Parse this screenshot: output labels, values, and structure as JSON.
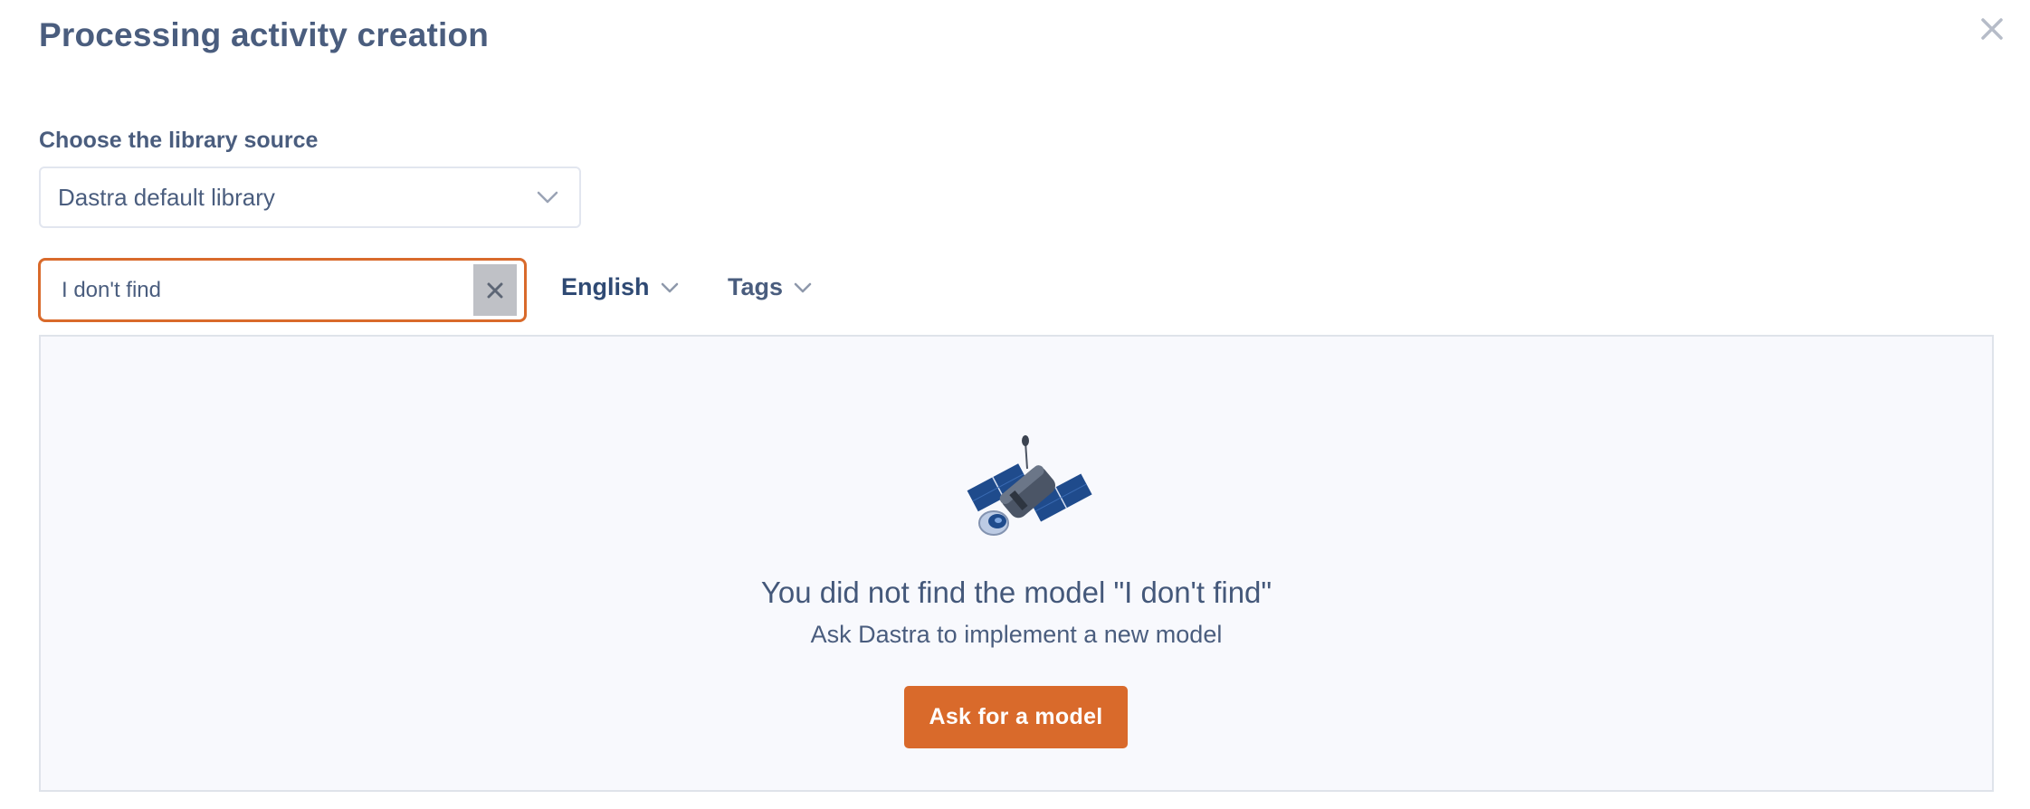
{
  "dialog": {
    "title": "Processing activity creation"
  },
  "library_source": {
    "label": "Choose the library source",
    "selected": "Dastra default library"
  },
  "search": {
    "value": "I don't find"
  },
  "filters": {
    "language": "English",
    "tags": "Tags"
  },
  "empty_state": {
    "title": "You did not find the model \"I don't find\"",
    "subtitle": "Ask Dastra to implement a new model",
    "button_label": "Ask for a model"
  },
  "icons": {
    "close": "close-icon",
    "chevron": "chevron-down-icon",
    "clear": "clear-search-icon",
    "illustration": "satellite-illustration"
  },
  "colors": {
    "accent": "#d96a2b",
    "text": "#4a5d7e",
    "panel_bg": "#f8f9fd"
  }
}
